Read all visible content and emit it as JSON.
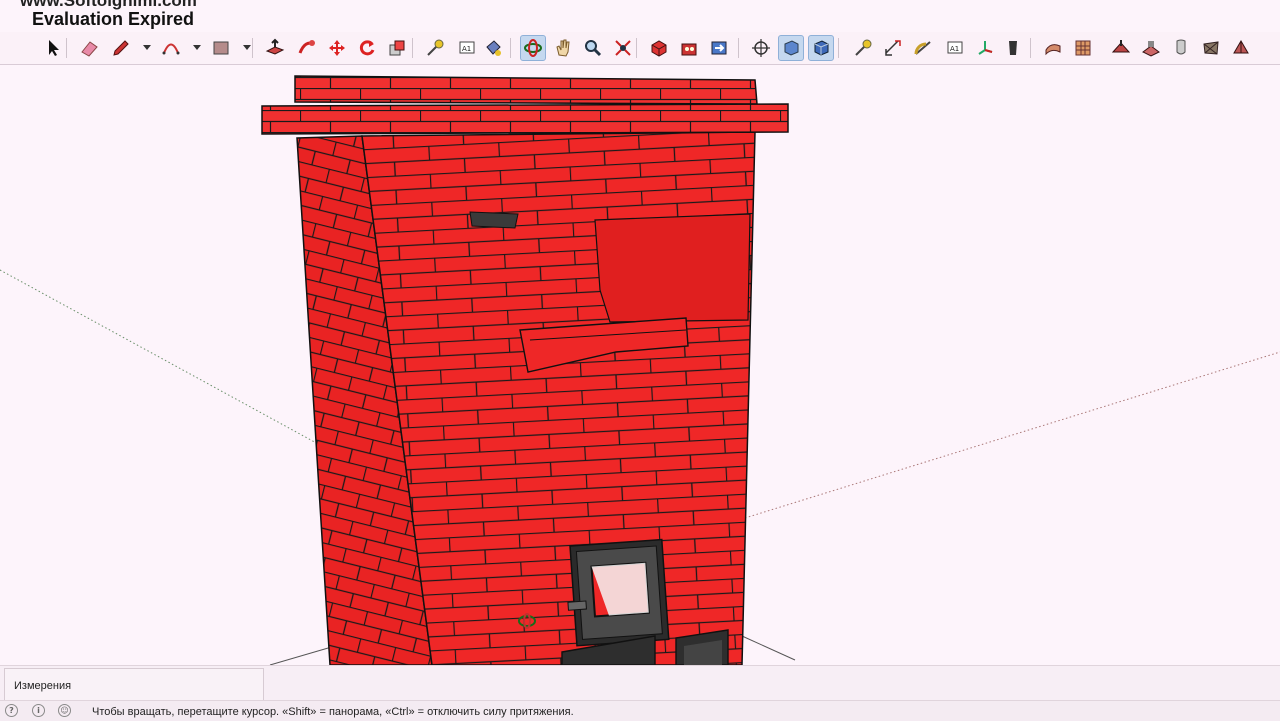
{
  "window": {
    "watermark_url": "www.Softolgnimi.com",
    "watermark_status": "Evaluation Expired"
  },
  "toolbar": {
    "tools": [
      {
        "name": "select",
        "icon": "arrow-cursor-icon"
      },
      {
        "name": "eraser",
        "icon": "eraser-icon"
      },
      {
        "name": "pencil",
        "icon": "pencil-icon"
      },
      {
        "name": "arc",
        "icon": "arc-icon"
      },
      {
        "name": "shape",
        "icon": "rectangle-icon"
      },
      {
        "name": "push-pull",
        "icon": "push-pull-icon"
      },
      {
        "name": "follow-me",
        "icon": "follow-me-icon"
      },
      {
        "name": "move",
        "icon": "move-icon"
      },
      {
        "name": "rotate",
        "icon": "rotate-icon"
      },
      {
        "name": "scale",
        "icon": "scale-icon"
      },
      {
        "name": "tape-measure",
        "icon": "tape-measure-icon"
      },
      {
        "name": "text",
        "icon": "text-icon"
      },
      {
        "name": "paint-bucket",
        "icon": "paint-bucket-icon"
      },
      {
        "name": "orbit",
        "icon": "orbit-icon",
        "active": true
      },
      {
        "name": "pan",
        "icon": "hand-icon"
      },
      {
        "name": "zoom",
        "icon": "magnifier-icon"
      },
      {
        "name": "zoom-extents",
        "icon": "zoom-extents-icon"
      },
      {
        "name": "components",
        "icon": "component-icon"
      },
      {
        "name": "warehouse",
        "icon": "warehouse-icon"
      },
      {
        "name": "send-to",
        "icon": "send-icon"
      },
      {
        "name": "position-camera",
        "icon": "crosshair-icon"
      },
      {
        "name": "xray",
        "icon": "xray-cube-icon",
        "active": true
      },
      {
        "name": "back-edges",
        "icon": "back-edges-cube-icon",
        "active": true
      },
      {
        "name": "tape-measure-2",
        "icon": "tape-measure-icon"
      },
      {
        "name": "dimension",
        "icon": "dimension-icon"
      },
      {
        "name": "protractor",
        "icon": "protractor-icon"
      },
      {
        "name": "text-2",
        "icon": "text-icon"
      },
      {
        "name": "axes",
        "icon": "axes-icon"
      },
      {
        "name": "3d-text",
        "icon": "3d-text-icon"
      },
      {
        "name": "sandbox-contours",
        "icon": "sandbox-contours-icon"
      },
      {
        "name": "sandbox-scratch",
        "icon": "sandbox-grid-icon"
      },
      {
        "name": "smoove",
        "icon": "smoove-icon"
      },
      {
        "name": "stamp",
        "icon": "stamp-icon"
      },
      {
        "name": "drape",
        "icon": "drape-icon"
      },
      {
        "name": "add-detail",
        "icon": "add-detail-icon"
      },
      {
        "name": "flip-edge",
        "icon": "flip-edge-icon"
      }
    ]
  },
  "viewport": {
    "model": "red-brick-stove",
    "brick_color": "#ef2727",
    "mortar_color": "#1a1a1a",
    "background_color": "#fdf4fb"
  },
  "measurements": {
    "label": "Измерения",
    "value": ""
  },
  "status": {
    "hint": "Чтобы вращать, перетащите курсор. «Shift» = панорама, «Ctrl» = отключить силу притяжения."
  }
}
